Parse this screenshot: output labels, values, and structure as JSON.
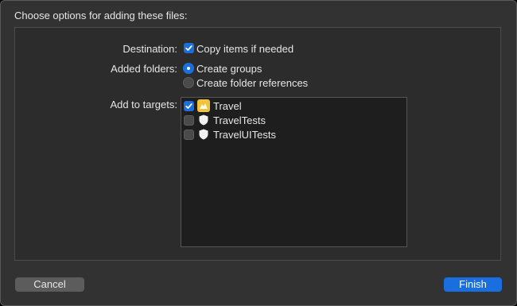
{
  "dialog": {
    "title": "Choose options for adding these files:"
  },
  "destination": {
    "label": "Destination:",
    "option_label": "Copy items if needed",
    "checked": true
  },
  "added_folders": {
    "label": "Added folders:",
    "options": [
      {
        "label": "Create groups",
        "selected": true
      },
      {
        "label": "Create folder references",
        "selected": false
      }
    ]
  },
  "targets": {
    "label": "Add to targets:",
    "items": [
      {
        "name": "Travel",
        "checked": true,
        "icon": "app-icon"
      },
      {
        "name": "TravelTests",
        "checked": false,
        "icon": "test-bundle-icon"
      },
      {
        "name": "TravelUITests",
        "checked": false,
        "icon": "test-bundle-icon"
      }
    ]
  },
  "buttons": {
    "cancel": "Cancel",
    "finish": "Finish"
  },
  "colors": {
    "accent": "#1a6fe0",
    "app_icon": "#f0c43a",
    "background": "#323232"
  }
}
